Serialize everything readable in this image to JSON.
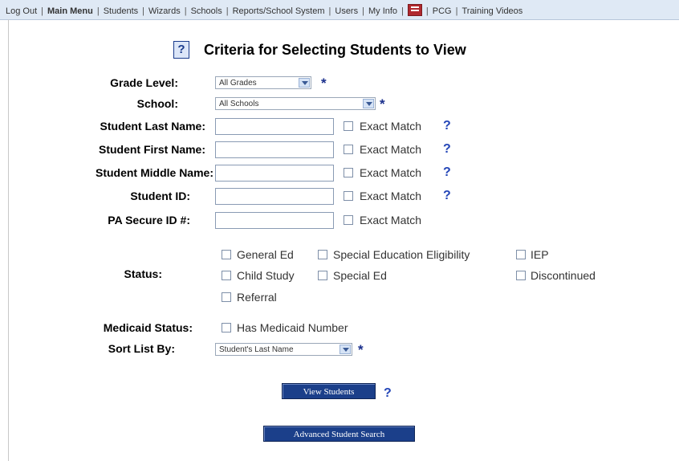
{
  "nav": {
    "items": [
      "Log Out",
      "Main Menu",
      "Students",
      "Wizards",
      "Schools",
      "Reports/School System",
      "Users",
      "My Info",
      "PCG",
      "Training Videos"
    ],
    "separator": "|"
  },
  "title": "Criteria for Selecting Students to View",
  "help_glyph": "?",
  "required_glyph": "*",
  "form": {
    "grade_level": {
      "label": "Grade Level:",
      "value": "All Grades"
    },
    "school": {
      "label": "School:",
      "value": "All Schools"
    },
    "last_name": {
      "label": "Student Last Name:",
      "exact": "Exact Match"
    },
    "first_name": {
      "label": "Student First Name:",
      "exact": "Exact Match"
    },
    "middle_name": {
      "label": "Student Middle Name:",
      "exact": "Exact Match"
    },
    "student_id": {
      "label": "Student ID:",
      "exact": "Exact Match"
    },
    "pa_secure_id": {
      "label": "PA Secure ID #:",
      "exact": "Exact Match"
    },
    "status": {
      "label": "Status:",
      "options": [
        "General Ed",
        "Special Education Eligibility",
        "IEP",
        "Child Study",
        "Special Ed",
        "Discontinued",
        "Referral"
      ]
    },
    "medicaid": {
      "label": "Medicaid Status:",
      "option": "Has Medicaid Number"
    },
    "sort": {
      "label": "Sort List By:",
      "value": "Student's Last Name"
    }
  },
  "buttons": {
    "view": "View Students",
    "advanced": "Advanced Student Search"
  },
  "colors": {
    "accent": "#1b3f8a",
    "nav_bg": "#dfe9f5",
    "help": "#2446b7"
  }
}
